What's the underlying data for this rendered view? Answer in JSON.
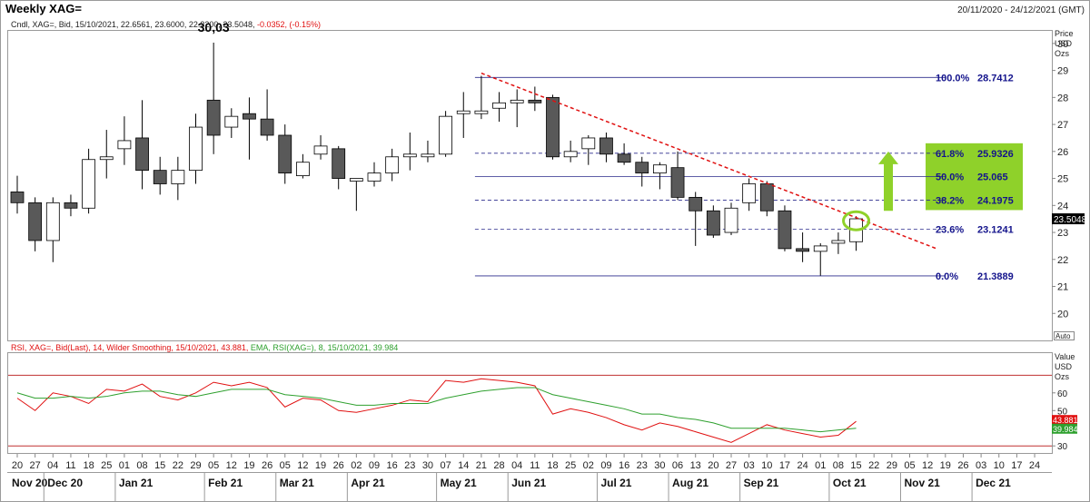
{
  "header": {
    "title": "Weekly XAG=",
    "date_range": "20/11/2020 - 24/12/2021 (GMT)"
  },
  "colors": {
    "bear_candle": "#595959",
    "bull_candle": "#ffffff",
    "candle_outline": "#000000",
    "fib_line": "#2b2b8c",
    "fib_label": "#14148c",
    "trendline": "#e01010",
    "rsi_line": "#e01010",
    "ema_line": "#2ea02e",
    "rsi_bounds": "#c03030",
    "highlight_box": "#8fd12a",
    "price_tag": "#000000"
  },
  "chart_data": [
    {
      "type": "candlestick",
      "legend": "Cndl, XAG=, Bid, 15/10/2021, 22.6561, 23.6000, 22.3200, 23.5048, -0.0352, (-0.15%)",
      "legend_change": "-0.0352, (-0.15%)",
      "axis_unit": [
        "Price",
        "USD",
        "Ozs"
      ],
      "ylim": [
        19,
        30.5
      ],
      "yticks": [
        20,
        21,
        22,
        23,
        24,
        25,
        26,
        27,
        28,
        29,
        30
      ],
      "auto_label": "Auto",
      "peak_annotation": {
        "text": "30,03",
        "x_index": 11,
        "value": 30.03
      },
      "last_price_tag": "23.5048",
      "candles": [
        {
          "o": 24.5,
          "h": 25.1,
          "l": 23.7,
          "c": 24.1
        },
        {
          "o": 24.1,
          "h": 24.3,
          "l": 22.3,
          "c": 22.7
        },
        {
          "o": 22.7,
          "h": 24.3,
          "l": 21.9,
          "c": 24.1
        },
        {
          "o": 24.1,
          "h": 24.4,
          "l": 23.6,
          "c": 23.9
        },
        {
          "o": 23.9,
          "h": 26.1,
          "l": 23.7,
          "c": 25.7
        },
        {
          "o": 25.7,
          "h": 26.8,
          "l": 25.0,
          "c": 25.8
        },
        {
          "o": 26.1,
          "h": 27.3,
          "l": 25.5,
          "c": 26.4
        },
        {
          "o": 26.5,
          "h": 27.9,
          "l": 24.6,
          "c": 25.3
        },
        {
          "o": 25.3,
          "h": 25.8,
          "l": 24.4,
          "c": 24.8
        },
        {
          "o": 24.8,
          "h": 25.8,
          "l": 24.2,
          "c": 25.3
        },
        {
          "o": 25.3,
          "h": 27.4,
          "l": 24.8,
          "c": 26.9
        },
        {
          "o": 27.9,
          "h": 30.03,
          "l": 25.9,
          "c": 26.6
        },
        {
          "o": 26.9,
          "h": 27.6,
          "l": 26.5,
          "c": 27.3
        },
        {
          "o": 27.4,
          "h": 28.0,
          "l": 25.7,
          "c": 27.2
        },
        {
          "o": 27.2,
          "h": 28.3,
          "l": 26.4,
          "c": 26.6
        },
        {
          "o": 26.6,
          "h": 27.0,
          "l": 24.8,
          "c": 25.2
        },
        {
          "o": 25.1,
          "h": 25.9,
          "l": 25.0,
          "c": 25.6
        },
        {
          "o": 25.9,
          "h": 26.6,
          "l": 25.7,
          "c": 26.2
        },
        {
          "o": 26.1,
          "h": 26.2,
          "l": 24.6,
          "c": 25.0
        },
        {
          "o": 24.9,
          "h": 25.0,
          "l": 23.8,
          "c": 25.0
        },
        {
          "o": 24.9,
          "h": 25.6,
          "l": 24.7,
          "c": 25.2
        },
        {
          "o": 25.2,
          "h": 26.1,
          "l": 24.9,
          "c": 25.8
        },
        {
          "o": 25.8,
          "h": 26.7,
          "l": 25.3,
          "c": 25.9
        },
        {
          "o": 25.8,
          "h": 26.4,
          "l": 25.6,
          "c": 25.9
        },
        {
          "o": 25.9,
          "h": 27.5,
          "l": 25.8,
          "c": 27.3
        },
        {
          "o": 27.4,
          "h": 28.2,
          "l": 26.5,
          "c": 27.5
        },
        {
          "o": 27.4,
          "h": 28.8,
          "l": 27.2,
          "c": 27.5
        },
        {
          "o": 27.6,
          "h": 28.2,
          "l": 27.1,
          "c": 27.8
        },
        {
          "o": 27.8,
          "h": 28.3,
          "l": 26.9,
          "c": 27.9
        },
        {
          "o": 27.9,
          "h": 28.4,
          "l": 27.5,
          "c": 27.8
        },
        {
          "o": 28.0,
          "h": 28.1,
          "l": 25.7,
          "c": 25.8
        },
        {
          "o": 25.8,
          "h": 26.4,
          "l": 25.6,
          "c": 26.0
        },
        {
          "o": 26.1,
          "h": 26.6,
          "l": 25.5,
          "c": 26.5
        },
        {
          "o": 26.5,
          "h": 26.7,
          "l": 25.6,
          "c": 25.9
        },
        {
          "o": 25.9,
          "h": 26.3,
          "l": 25.5,
          "c": 25.6
        },
        {
          "o": 25.6,
          "h": 25.8,
          "l": 24.7,
          "c": 25.2
        },
        {
          "o": 25.2,
          "h": 25.6,
          "l": 24.6,
          "c": 25.5
        },
        {
          "o": 25.4,
          "h": 26.0,
          "l": 24.2,
          "c": 24.3
        },
        {
          "o": 24.3,
          "h": 24.5,
          "l": 22.5,
          "c": 23.8
        },
        {
          "o": 23.8,
          "h": 24.0,
          "l": 22.8,
          "c": 22.9
        },
        {
          "o": 23.0,
          "h": 24.1,
          "l": 22.9,
          "c": 23.9
        },
        {
          "o": 24.1,
          "h": 25.0,
          "l": 23.8,
          "c": 24.8
        },
        {
          "o": 24.8,
          "h": 24.9,
          "l": 23.6,
          "c": 23.8
        },
        {
          "o": 23.8,
          "h": 24.0,
          "l": 22.3,
          "c": 22.4
        },
        {
          "o": 22.4,
          "h": 23.0,
          "l": 21.9,
          "c": 22.3
        },
        {
          "o": 22.3,
          "h": 22.6,
          "l": 21.4,
          "c": 22.5
        },
        {
          "o": 22.6,
          "h": 23.0,
          "l": 22.2,
          "c": 22.7
        },
        {
          "o": 22.6561,
          "h": 23.6,
          "l": 22.32,
          "c": 23.5048
        }
      ],
      "x_ticks": [
        "20",
        "27",
        "04",
        "11",
        "18",
        "25",
        "01",
        "08",
        "15",
        "22",
        "29",
        "05",
        "12",
        "19",
        "26",
        "05",
        "12",
        "19",
        "26",
        "02",
        "09",
        "16",
        "23",
        "30",
        "07",
        "14",
        "21",
        "28",
        "04",
        "11",
        "18",
        "25",
        "02",
        "09",
        "16",
        "23",
        "30",
        "06",
        "13",
        "20",
        "27",
        "03",
        "10",
        "17",
        "24",
        "01",
        "08",
        "15",
        "22",
        "29",
        "05",
        "12",
        "19",
        "26",
        "03",
        "10",
        "17",
        "24"
      ],
      "x_months": [
        "Nov 20",
        "Dec 20",
        "Jan 21",
        "Feb 21",
        "Mar 21",
        "Apr 21",
        "May 21",
        "Jun 21",
        "Jul 21",
        "Aug 21",
        "Sep 21",
        "Oct 21",
        "Nov 21",
        "Dec 21"
      ],
      "fib_levels": [
        {
          "label": "100.0%",
          "value": 28.7412,
          "value_text": "28.7412",
          "style": "solid"
        },
        {
          "label": "61.8%",
          "value": 25.9326,
          "value_text": "25.9326",
          "style": "dashed"
        },
        {
          "label": "50.0%",
          "value": 25.065,
          "value_text": "25.065",
          "style": "solid"
        },
        {
          "label": "38.2%",
          "value": 24.1975,
          "value_text": "24.1975",
          "style": "dashed"
        },
        {
          "label": "23.6%",
          "value": 23.1241,
          "value_text": "23.1241",
          "style": "dashed"
        },
        {
          "label": "0.0%",
          "value": 21.3889,
          "value_text": "21.3889",
          "style": "solid"
        }
      ],
      "fib_x_range": [
        26,
        52
      ],
      "trendline": {
        "x1": 26,
        "y1": 28.9,
        "x2": 51.5,
        "y2": 22.4
      }
    },
    {
      "type": "line",
      "legend_rsi": "RSI, XAG=, Bid(Last), 14, Wilder Smoothing, 15/10/2021, 43.881",
      "legend_ema": "EMA, RSI(XAG=), 8, 15/10/2021, 39.984",
      "axis_unit": [
        "Value",
        "USD",
        "Ozs"
      ],
      "ylim": [
        26,
        83
      ],
      "yticks": [
        30,
        40,
        50,
        60
      ],
      "bounds": [
        70,
        30
      ],
      "last_tags": [
        {
          "text": "43.881",
          "color": "#e01010"
        },
        {
          "text": "39.984",
          "color": "#2ea02e"
        }
      ],
      "series": [
        {
          "name": "RSI",
          "values": [
            57,
            50,
            60,
            58,
            54,
            62,
            61,
            65,
            58,
            56,
            60,
            66,
            64,
            66,
            63,
            52,
            57,
            56,
            50,
            49,
            51,
            53,
            56,
            55,
            67,
            66,
            68,
            67,
            66,
            64,
            48,
            51,
            49,
            46,
            42,
            39,
            43,
            41,
            38,
            35,
            32,
            37,
            42,
            39,
            37,
            35,
            36,
            43.881
          ]
        },
        {
          "name": "EMA",
          "values": [
            60,
            57,
            57,
            58,
            57,
            58,
            60,
            61,
            61,
            59,
            58,
            60,
            62,
            62,
            62,
            59,
            58,
            57,
            55,
            53,
            53,
            54,
            54,
            54,
            57,
            59,
            61,
            62,
            63,
            63,
            59,
            57,
            55,
            53,
            51,
            48,
            48,
            46,
            45,
            43,
            40,
            40,
            40,
            40,
            39,
            38,
            39,
            39.984
          ]
        }
      ]
    }
  ]
}
